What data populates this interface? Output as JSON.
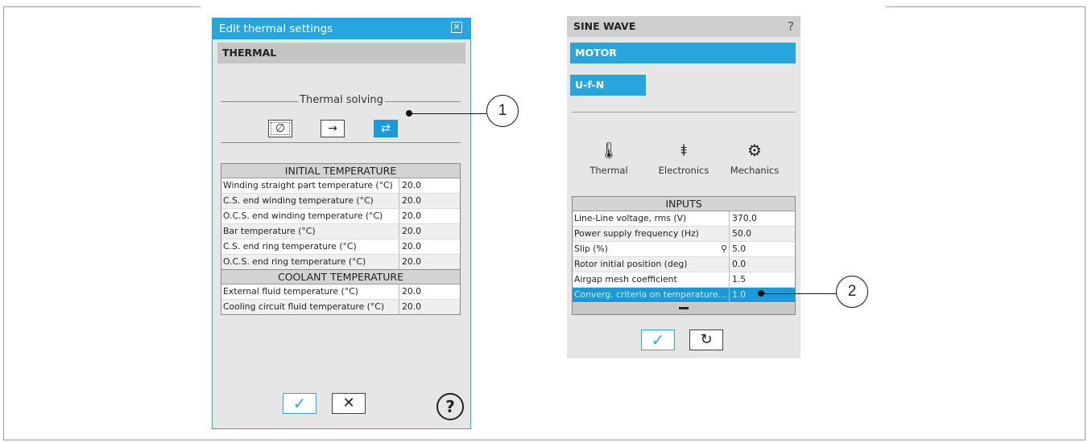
{
  "left_dialog": {
    "title": "Edit thermal settings",
    "section": "THERMAL",
    "group_label": "Thermal solving",
    "modes": [
      {
        "symbol": "∅",
        "name": "none"
      },
      {
        "symbol": "→",
        "name": "one-way"
      },
      {
        "symbol": "⇄",
        "name": "two-way",
        "selected": true
      }
    ],
    "initial_table": {
      "header": "INITIAL TEMPERATURE",
      "rows": [
        {
          "label": "Winding straight part temperature (°C)",
          "value": "20.0"
        },
        {
          "label": "C.S. end winding temperature (°C)",
          "value": "20.0"
        },
        {
          "label": "O.C.S. end winding temperature (°C)",
          "value": "20.0"
        },
        {
          "label": "Bar temperature (°C)",
          "value": "20.0"
        },
        {
          "label": "C.S. end ring temperature (°C)",
          "value": "20.0"
        },
        {
          "label": "O.C.S. end ring temperature (°C)",
          "value": "20.0"
        }
      ]
    },
    "coolant_table": {
      "header": "COOLANT TEMPERATURE",
      "rows": [
        {
          "label": "External fluid temperature (°C)",
          "value": "20.0"
        },
        {
          "label": "Cooling circuit fluid temperature (°C)",
          "value": "20.0"
        }
      ]
    },
    "ok_symbol": "✓",
    "cancel_symbol": "✕",
    "help_symbol": "?"
  },
  "callouts": [
    "1",
    "2"
  ],
  "right_panel": {
    "title": "SINE WAVE",
    "help": "?",
    "motor_tab": "MOTOR",
    "mode_tab": "U-f-N",
    "tools": [
      {
        "label": "Thermal",
        "icon": "thermometer-icon",
        "glyph": "🌡"
      },
      {
        "label": "Electronics",
        "icon": "diode-icon",
        "glyph": "⯒"
      },
      {
        "label": "Mechanics",
        "icon": "gears-icon",
        "glyph": "⚙"
      }
    ],
    "inputs": {
      "header": "INPUTS",
      "rows": [
        {
          "label": "Line-Line voltage, rms (V)",
          "value": "370.0"
        },
        {
          "label": "Power supply frequency (Hz)",
          "value": "50.0"
        },
        {
          "label": "Slip (%)",
          "value": "5.0"
        },
        {
          "label": "Rotor initial position (deg)",
          "value": "0.0"
        },
        {
          "label": "Airgap mesh coefficient",
          "value": "1.5"
        },
        {
          "label": "Converg. criteria on temperature...",
          "value": "1.0"
        }
      ]
    },
    "ok_symbol": "✓",
    "reset_symbol": "↻"
  }
}
